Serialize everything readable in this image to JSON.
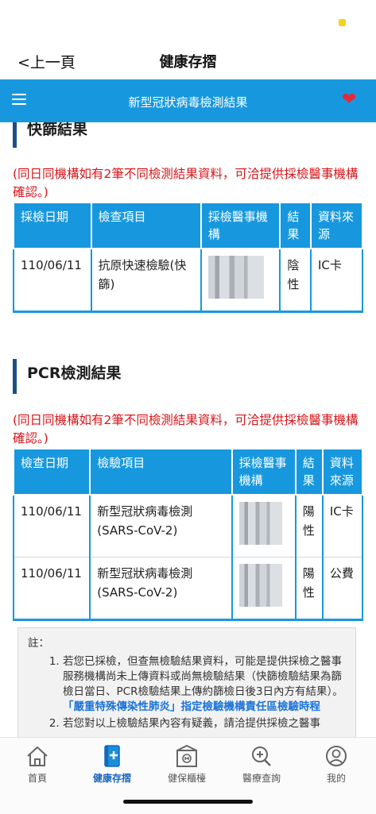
{
  "header": {
    "back_label": "<上一頁",
    "title": "健康存摺"
  },
  "subheader": {
    "title": "新型冠狀病毒檢測結果",
    "menu_icon": "menu-icon",
    "favorite_icon": "heart-icon"
  },
  "rapid": {
    "section_title": "快篩結果",
    "notice": "(同日同機構如有2筆不同檢測結果資料，可洽提供採檢醫事機構確認。)",
    "columns": [
      "採檢日期",
      "檢查項目",
      "採檢醫事機構",
      "結果",
      "資料來源"
    ],
    "rows": [
      {
        "date": "110/06/11",
        "item": "抗原快速檢驗(快篩)",
        "result": "陰性",
        "source": "IC卡"
      }
    ]
  },
  "pcr": {
    "section_title": "PCR檢測結果",
    "notice": "(同日同機構如有2筆不同檢測結果資料，可洽提供採檢醫事機構確認。)",
    "columns": [
      "檢查日期",
      "檢驗項目",
      "採檢醫事機構",
      "結果",
      "資料來源"
    ],
    "rows": [
      {
        "date": "110/06/11",
        "item": "新型冠狀病毒檢測(SARS-CoV-2)",
        "result": "陽性",
        "source": "IC卡"
      },
      {
        "date": "110/06/11",
        "item": "新型冠狀病毒檢測(SARS-CoV-2)",
        "result": "陽性",
        "source": "公費"
      }
    ]
  },
  "notes": {
    "label": "註：",
    "item1_text": "若您已採檢，但查無檢驗結果資料，可能是提供採檢之醫事服務機構尚未上傳資料或尚無檢驗結果（快篩檢驗結果為篩檢日當日、PCR檢驗結果上傳約篩檢日後3日內方有結果）。",
    "item1_link": "「嚴重特殊傳染性肺炎」指定檢驗機構責任區檢驗時程",
    "item2_text": "若您對以上檢驗結果內容有疑義，請洽提供採檢之醫事"
  },
  "tabs": [
    {
      "label": "首頁",
      "icon": "home-icon"
    },
    {
      "label": "健康存摺",
      "icon": "health-book-icon"
    },
    {
      "label": "健保櫃檯",
      "icon": "counter-icon"
    },
    {
      "label": "醫療查詢",
      "icon": "search-medical-icon"
    },
    {
      "label": "我的",
      "icon": "profile-icon"
    }
  ],
  "colors": {
    "brand_blue": "#1798de",
    "notice_red": "#d9161b",
    "section_bar": "#1c4e86",
    "heart": "#e8283a"
  }
}
